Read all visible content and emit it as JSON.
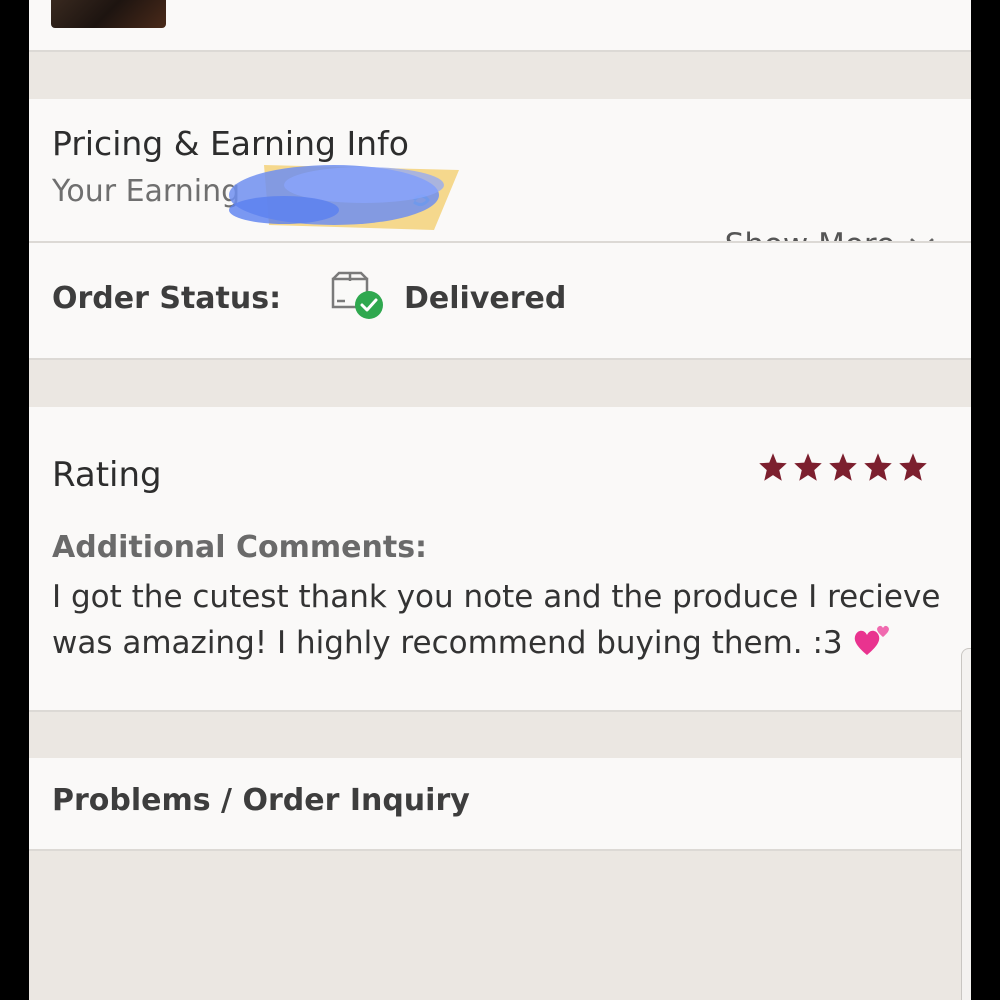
{
  "pricing": {
    "title": "Pricing & Earning Info",
    "subtitle": "Your Earning",
    "show_more_label": "Show More"
  },
  "order": {
    "status_label": "Order Status:",
    "status_value": "Delivered",
    "status_icon": "package-delivered-icon"
  },
  "rating": {
    "title": "Rating",
    "stars": 5,
    "max_stars": 5,
    "star_color": "#7c1f2e",
    "additional_label": "Additional Comments:",
    "comment": "I got the cutest thank you note and the produce I recieve was amazing! I highly recommend buying them. :3"
  },
  "problems": {
    "label": "Problems / Order Inquiry"
  },
  "colors": {
    "background": "#ebe7e2",
    "card": "#faf9f8",
    "check_green": "#2fa84f"
  }
}
